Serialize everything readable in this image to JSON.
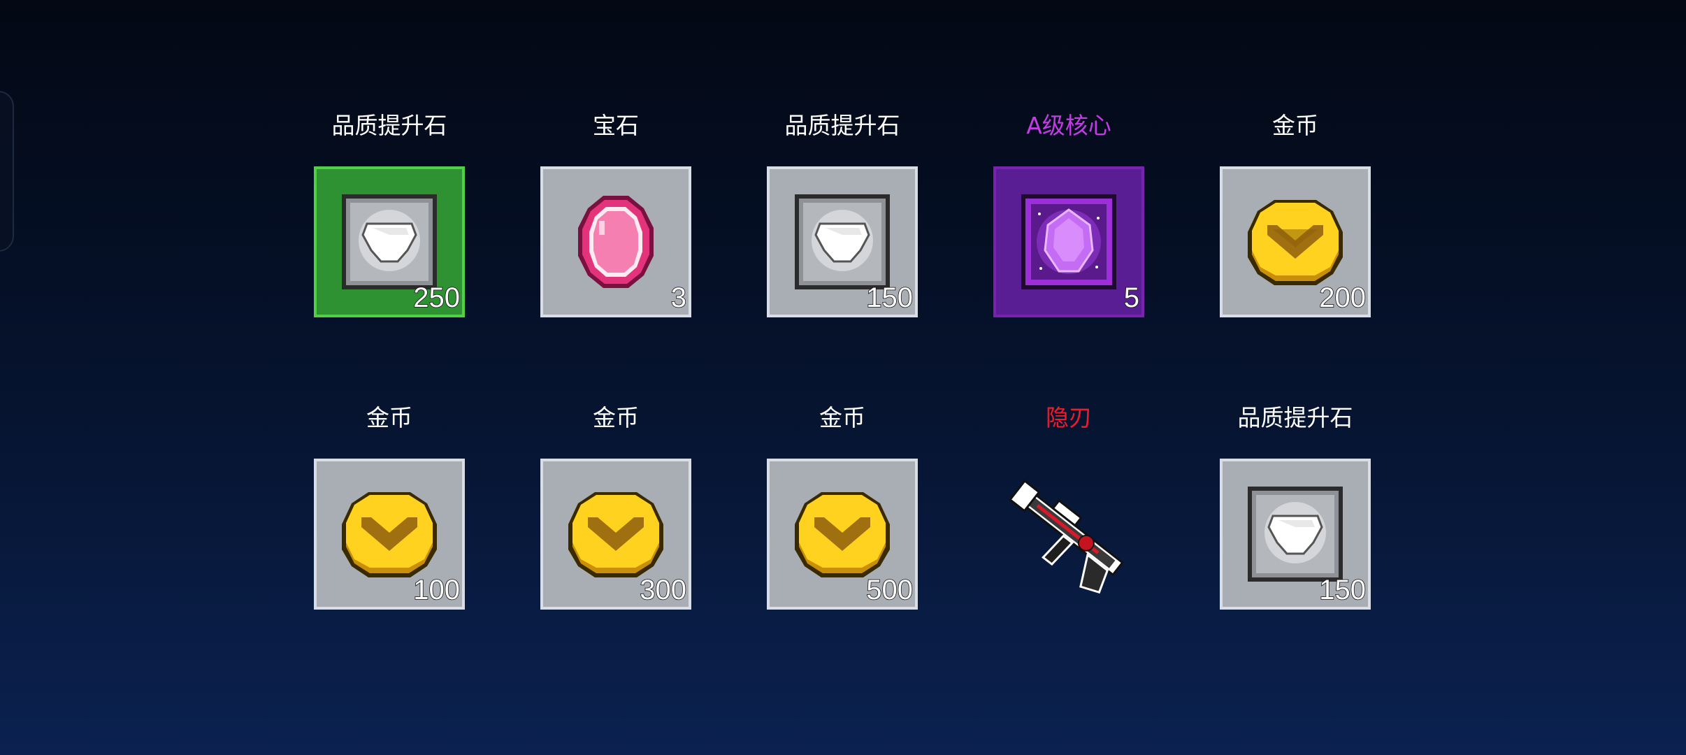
{
  "rewards": [
    {
      "name": "品质提升石",
      "count": "250",
      "icon": "quality-stone-icon",
      "rarity": "green",
      "name_color": "#ffffff"
    },
    {
      "name": "宝石",
      "count": "3",
      "icon": "gem-icon",
      "rarity": "common",
      "name_color": "#ffffff"
    },
    {
      "name": "品质提升石",
      "count": "150",
      "icon": "quality-stone-icon",
      "rarity": "common",
      "name_color": "#ffffff"
    },
    {
      "name": "A级核心",
      "count": "5",
      "icon": "a-core-icon",
      "rarity": "purple",
      "name_color": "#c43be6"
    },
    {
      "name": "金币",
      "count": "200",
      "icon": "gold-coin-icon",
      "rarity": "common",
      "name_color": "#ffffff"
    },
    {
      "name": "金币",
      "count": "100",
      "icon": "gold-coin-icon",
      "rarity": "common",
      "name_color": "#ffffff"
    },
    {
      "name": "金币",
      "count": "300",
      "icon": "gold-coin-icon",
      "rarity": "common",
      "name_color": "#ffffff"
    },
    {
      "name": "金币",
      "count": "500",
      "icon": "gold-coin-icon",
      "rarity": "common",
      "name_color": "#ffffff"
    },
    {
      "name": "隐刃",
      "count": "",
      "icon": "gun-icon",
      "rarity": "weapon",
      "name_color": "#ee1c2b"
    },
    {
      "name": "品质提升石",
      "count": "150",
      "icon": "quality-stone-icon",
      "rarity": "common",
      "name_color": "#ffffff"
    }
  ]
}
